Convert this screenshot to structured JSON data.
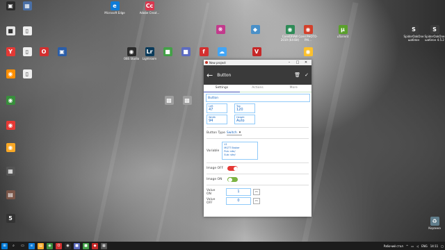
{
  "desktop": {
    "icons": [
      {
        "label": "",
        "glyph": "▣",
        "color": "#2b2b2b"
      },
      {
        "label": "",
        "glyph": "▦",
        "color": "#4a6fa5"
      },
      {
        "label": "Microsoft Edge",
        "glyph": "e",
        "color": "#0f7bd6"
      },
      {
        "label": "Adobe Creat...",
        "glyph": "Cc",
        "color": "#d9384f"
      },
      {
        "label": "",
        "glyph": "■",
        "color": "#e6e6e6"
      },
      {
        "label": "",
        "glyph": "❋",
        "color": "#c23a8c"
      },
      {
        "label": "",
        "glyph": "◆",
        "color": "#4a90c8"
      },
      {
        "label": "CorelDRAW 2019 (64-Bit)",
        "glyph": "◉",
        "color": "#2e8b57"
      },
      {
        "label": "Corel PHOTO-PAI...",
        "glyph": "◉",
        "color": "#d3402b"
      },
      {
        "label": "uTorrent",
        "glyph": "µ",
        "color": "#5aa02c"
      },
      {
        "label": "SpiderOakOne шаблон",
        "glyph": "S",
        "color": "#3b3b3b"
      },
      {
        "label": "Yandex",
        "glyph": "Y",
        "color": "#e53935"
      },
      {
        "label": "Opera",
        "glyph": "O",
        "color": "#d32f2f"
      },
      {
        "label": "",
        "glyph": "▣",
        "color": "#2a5da8"
      },
      {
        "label": "OBS Studio",
        "glyph": "◉",
        "color": "#2b2b2b"
      },
      {
        "label": "Lightroom",
        "glyph": "Lr",
        "color": "#0b3b5a"
      },
      {
        "label": "",
        "glyph": "■",
        "color": "#43a047"
      },
      {
        "label": "",
        "glyph": "■",
        "color": "#5c6bc0"
      },
      {
        "label": "",
        "glyph": "f",
        "color": "#d32f2f"
      },
      {
        "label": "",
        "glyph": "☁",
        "color": "#42a5f5"
      },
      {
        "label": "",
        "glyph": "V",
        "color": "#c62828"
      },
      {
        "label": "",
        "glyph": "◉",
        "color": "#fbc02d"
      },
      {
        "label": "SpiderOakOne шаблон 4.5.2",
        "glyph": "S",
        "color": "#3b3b3b"
      },
      {
        "label": "",
        "glyph": "◉",
        "color": "#ff8f00"
      },
      {
        "label": "",
        "glyph": "◉",
        "color": "#388e3c"
      },
      {
        "label": "",
        "glyph": "◉",
        "color": "#e53935"
      },
      {
        "label": "",
        "glyph": "◉",
        "color": "#f9a825"
      },
      {
        "label": "",
        "glyph": "▦",
        "color": "#555"
      },
      {
        "label": "",
        "glyph": "▤",
        "color": "#795548"
      },
      {
        "label": "",
        "glyph": "5",
        "color": "#333"
      },
      {
        "label": "",
        "glyph": "▩",
        "color": "#9e9e9e"
      },
      {
        "label": "",
        "glyph": "▩",
        "color": "#9e9e9e"
      },
      {
        "label": "Корзина",
        "glyph": "🗑",
        "color": "#607d8b"
      }
    ]
  },
  "window": {
    "title": "New project",
    "header_title": "Button",
    "tabs": [
      "Settings",
      "Actions",
      "More"
    ],
    "name_value": "Button",
    "left": {
      "label": "Left",
      "value": "47"
    },
    "top": {
      "label": "Top",
      "value": "120"
    },
    "width": {
      "label": "Width",
      "value": "94"
    },
    "height": {
      "label": "Height",
      "value": "Auto"
    },
    "button_type_label": "Button Type",
    "button_type_value": "Switch",
    "variable_label": "Variable",
    "variable_lines": [
      "V1",
      "MQTT Broker",
      "Pub: site/",
      "Sub: site/"
    ],
    "image_off_label": "Image OFF",
    "image_on_label": "Image ON",
    "value_on_label": "Value ON",
    "value_on": "1",
    "value_off_label": "Value OFF",
    "value_off": "0"
  },
  "taskbar": {
    "lang": "ENG",
    "time": "14:11",
    "desktop_label": "Рабочий стол"
  },
  "colors": {
    "header_bg": "#3a3a3a",
    "accent_blue": "#1565c0",
    "toggle_off": "#e53935",
    "toggle_on": "#7cb342"
  }
}
